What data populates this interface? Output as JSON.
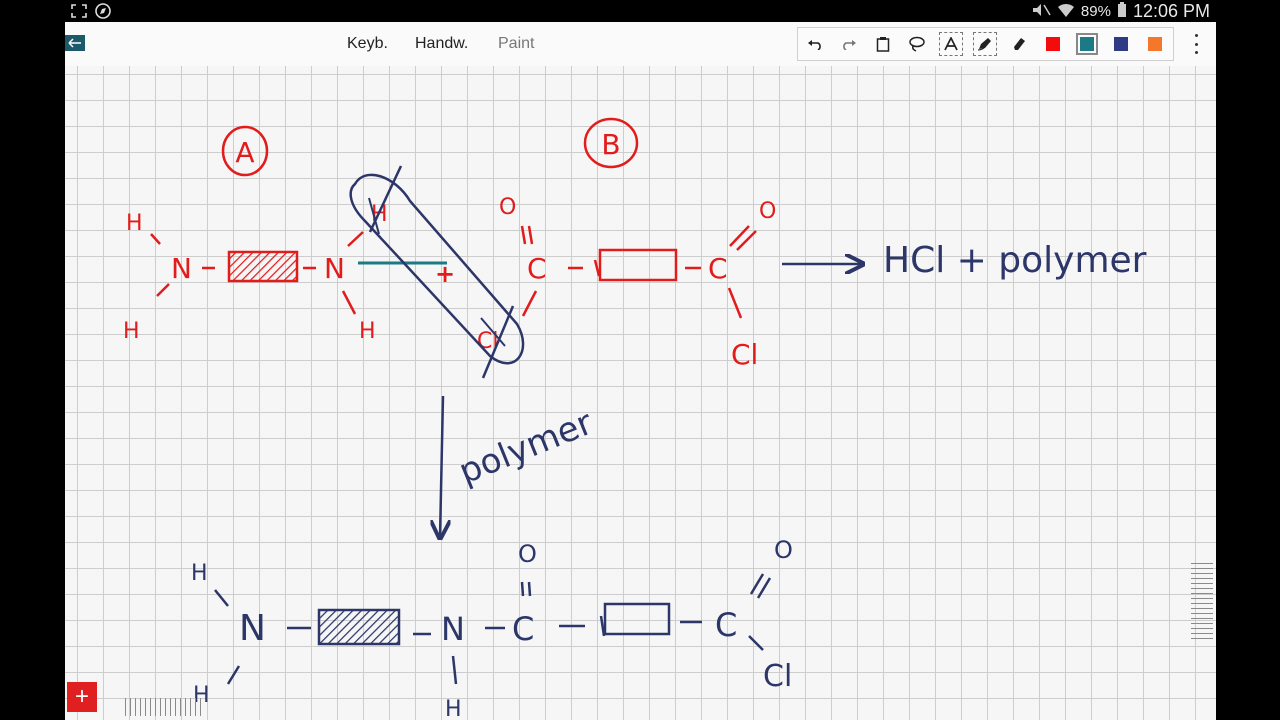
{
  "status": {
    "battery": "89%",
    "time": "12:06 PM"
  },
  "toolbar": {
    "modes": [
      "Keyb.",
      "Handw.",
      "Paint"
    ],
    "colors": [
      "#f40b0b",
      "#1b7a86",
      "#2f3b85",
      "#f4772c"
    ],
    "selected_color": "#1b7a86"
  },
  "drawing": {
    "label_a": "A",
    "label_b": "B",
    "mol_top": {
      "h_upper": "H",
      "n_left": "N",
      "h_lower": "H",
      "n_right": "N",
      "h_under": "H",
      "h_circled": "H",
      "o_left": "O",
      "c_left": "C",
      "c_right": "C",
      "o_right": "O",
      "cl_circled": "Cl",
      "cl_right": "Cl"
    },
    "products": "HCl + polymer",
    "arrow_label": "polymer",
    "mol_bottom": {
      "h_upper": "H",
      "n_left": "N",
      "h_lower": "H",
      "n_mid": "N",
      "h_under": "H",
      "o_left": "O",
      "c_left": "C",
      "c_right": "C",
      "o_right": "O",
      "cl": "Cl"
    }
  }
}
